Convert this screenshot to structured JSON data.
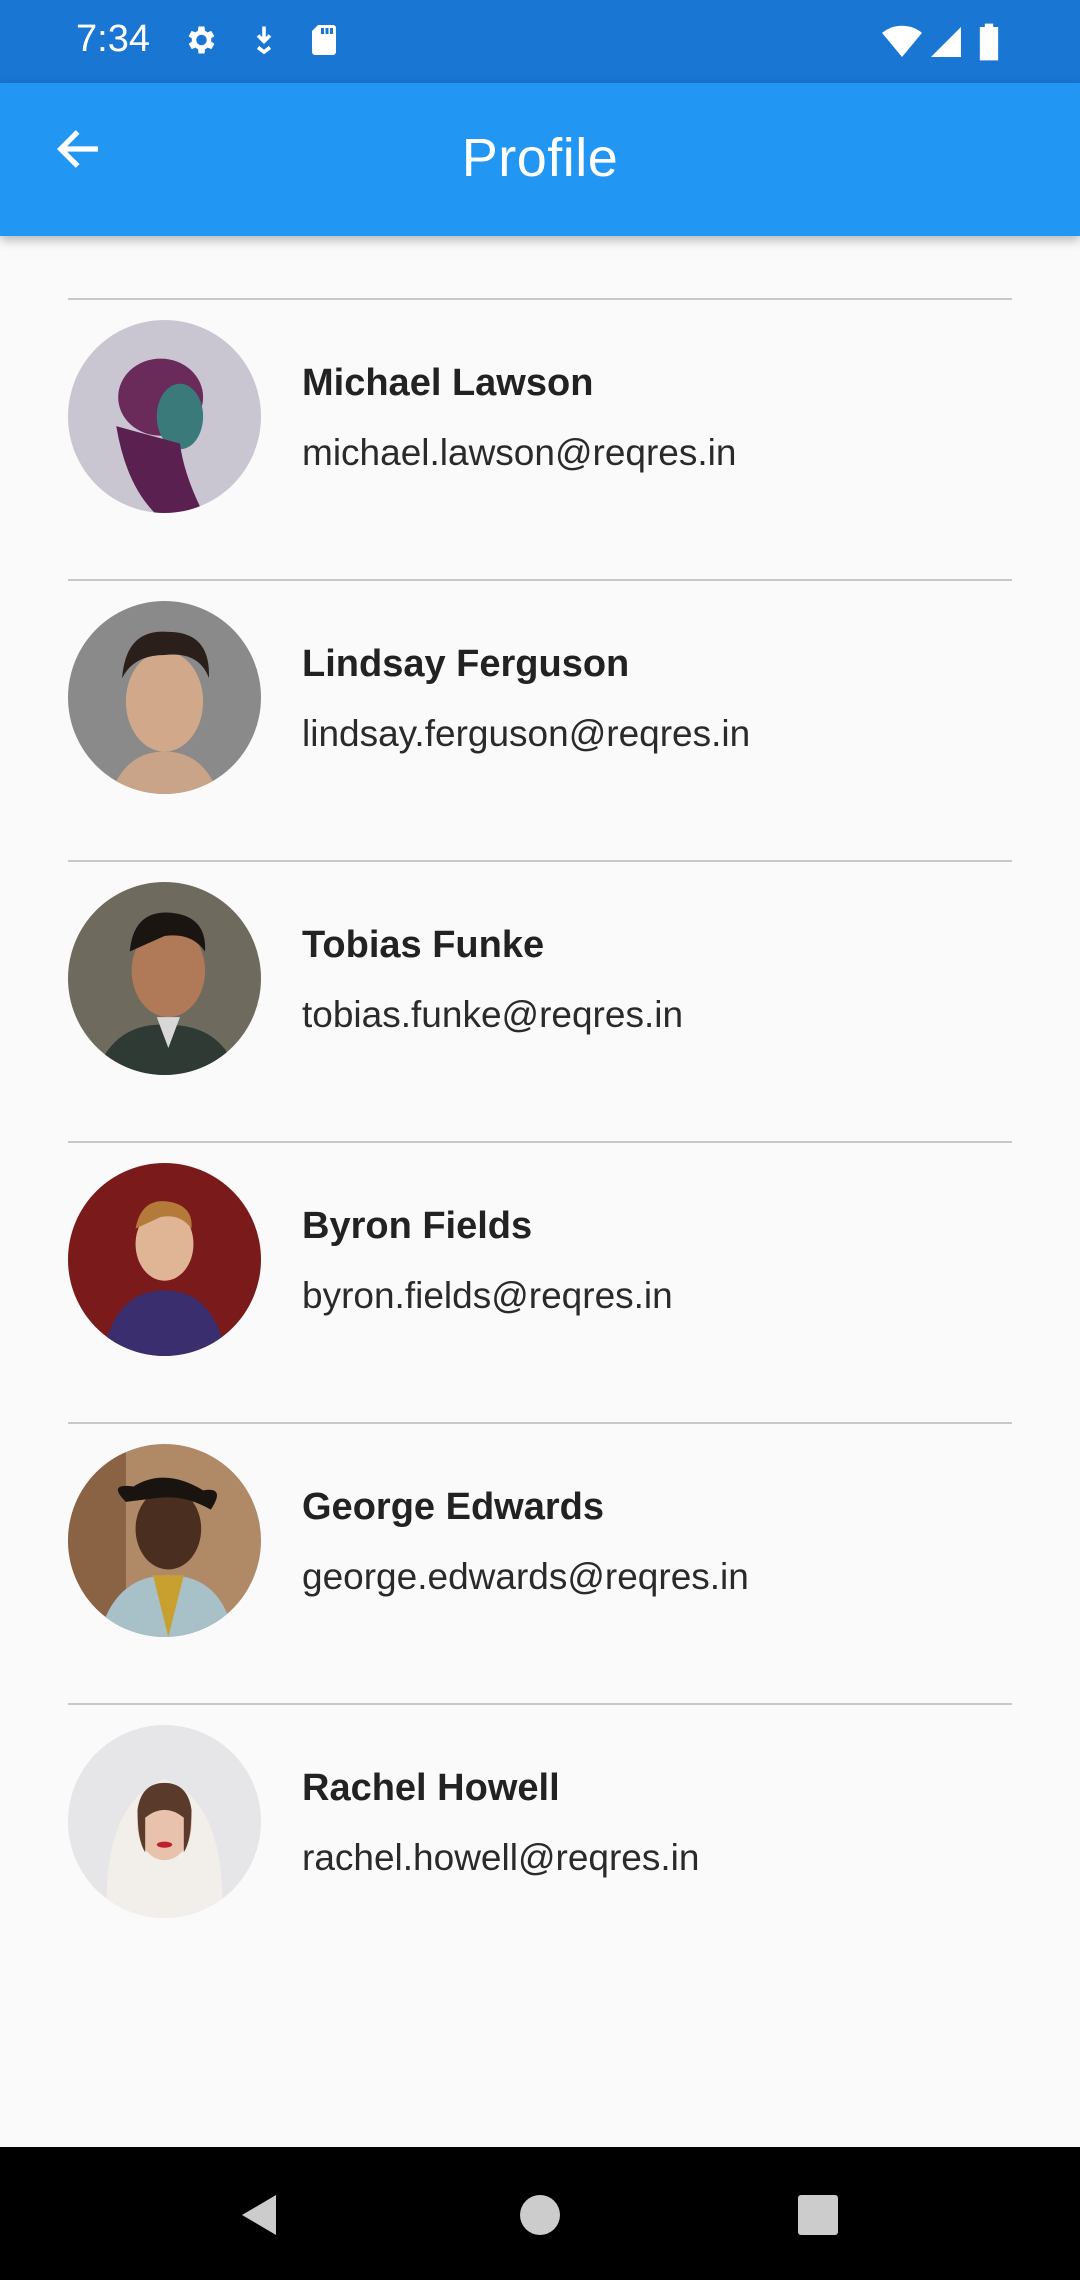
{
  "status_bar": {
    "time": "7:34",
    "icons": [
      "settings-gear-icon",
      "download-icon",
      "sd-card-icon",
      "wifi-icon",
      "cell-signal-icon",
      "battery-icon"
    ]
  },
  "app_bar": {
    "title": "Profile",
    "back_icon": "arrow-back-icon"
  },
  "profiles": [
    {
      "name": "Michael Lawson",
      "email": "michael.lawson@reqres.in"
    },
    {
      "name": "Lindsay Ferguson",
      "email": "lindsay.ferguson@reqres.in"
    },
    {
      "name": "Tobias Funke",
      "email": "tobias.funke@reqres.in"
    },
    {
      "name": "Byron Fields",
      "email": "byron.fields@reqres.in"
    },
    {
      "name": "George Edwards",
      "email": "george.edwards@reqres.in"
    },
    {
      "name": "Rachel Howell",
      "email": "rachel.howell@reqres.in"
    }
  ],
  "nav_bar": {
    "icons": [
      "back-triangle-icon",
      "home-circle-icon",
      "recents-square-icon"
    ]
  },
  "colors": {
    "status_bar": "#1976d2",
    "app_bar": "#2196f3",
    "background": "#fafafa",
    "divider": "#c8c8c8"
  }
}
